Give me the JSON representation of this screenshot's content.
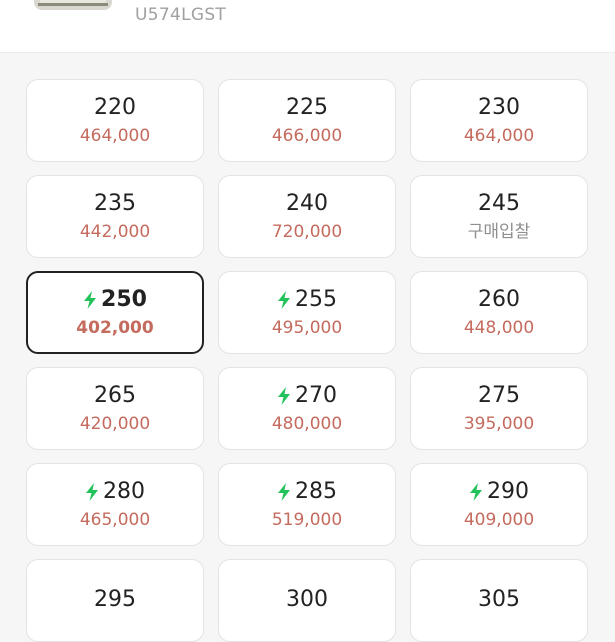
{
  "header": {
    "product_code": "U574LGST",
    "colors": {
      "background": "#ffffff"
    }
  },
  "colors": {
    "price": "#c46b5e",
    "bid_text": "#8f8f8f",
    "bolt": "#22c25a",
    "selected_border": "#222222"
  },
  "sizes": [
    {
      "size": "220",
      "price": "464,000",
      "fast": false,
      "selected": false,
      "bid": false
    },
    {
      "size": "225",
      "price": "466,000",
      "fast": false,
      "selected": false,
      "bid": false
    },
    {
      "size": "230",
      "price": "464,000",
      "fast": false,
      "selected": false,
      "bid": false
    },
    {
      "size": "235",
      "price": "442,000",
      "fast": false,
      "selected": false,
      "bid": false
    },
    {
      "size": "240",
      "price": "720,000",
      "fast": false,
      "selected": false,
      "bid": false
    },
    {
      "size": "245",
      "price": "구매입찰",
      "fast": false,
      "selected": false,
      "bid": true
    },
    {
      "size": "250",
      "price": "402,000",
      "fast": true,
      "selected": true,
      "bid": false
    },
    {
      "size": "255",
      "price": "495,000",
      "fast": true,
      "selected": false,
      "bid": false
    },
    {
      "size": "260",
      "price": "448,000",
      "fast": false,
      "selected": false,
      "bid": false
    },
    {
      "size": "265",
      "price": "420,000",
      "fast": false,
      "selected": false,
      "bid": false
    },
    {
      "size": "270",
      "price": "480,000",
      "fast": true,
      "selected": false,
      "bid": false
    },
    {
      "size": "275",
      "price": "395,000",
      "fast": false,
      "selected": false,
      "bid": false
    },
    {
      "size": "280",
      "price": "465,000",
      "fast": true,
      "selected": false,
      "bid": false
    },
    {
      "size": "285",
      "price": "519,000",
      "fast": true,
      "selected": false,
      "bid": false
    },
    {
      "size": "290",
      "price": "409,000",
      "fast": true,
      "selected": false,
      "bid": false
    },
    {
      "size": "295",
      "price": "",
      "fast": false,
      "selected": false,
      "bid": false
    },
    {
      "size": "300",
      "price": "",
      "fast": false,
      "selected": false,
      "bid": false
    },
    {
      "size": "305",
      "price": "",
      "fast": false,
      "selected": false,
      "bid": true
    }
  ]
}
